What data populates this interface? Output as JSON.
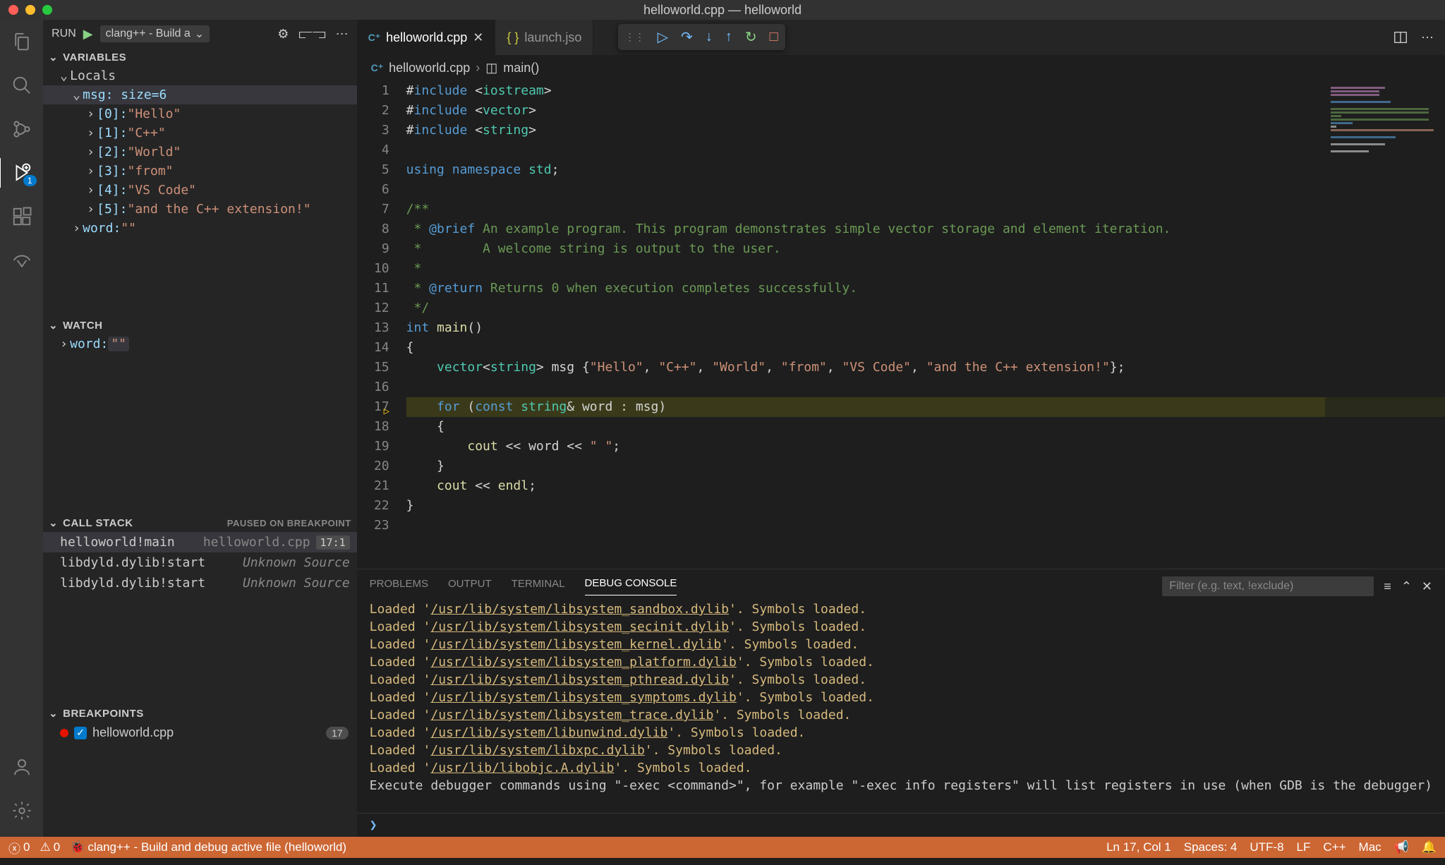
{
  "title": "helloworld.cpp — helloworld",
  "run": {
    "label": "RUN",
    "config": "clang++ - Build a"
  },
  "activity_badge": "1",
  "sections": {
    "variables": "VARIABLES",
    "watch": "WATCH",
    "callstack": "CALL STACK",
    "paused": "PAUSED ON BREAKPOINT",
    "breakpoints": "BREAKPOINTS"
  },
  "variables": {
    "locals": "Locals",
    "msg_label": "msg: size=6",
    "items": [
      {
        "idx": "[0]:",
        "val": "\"Hello\""
      },
      {
        "idx": "[1]:",
        "val": "\"C++\""
      },
      {
        "idx": "[2]:",
        "val": "\"World\""
      },
      {
        "idx": "[3]:",
        "val": "\"from\""
      },
      {
        "idx": "[4]:",
        "val": "\"VS Code\""
      },
      {
        "idx": "[5]:",
        "val": "\"and the C++ extension!\""
      }
    ],
    "word_label": "word:",
    "word_val": "\"\""
  },
  "watch": {
    "word_label": "word:",
    "word_val": "\"\""
  },
  "callstack": [
    {
      "name": "helloworld!main",
      "file": "helloworld.cpp",
      "loc": "17:1"
    },
    {
      "name": "libdyld.dylib!start",
      "file": "Unknown Source"
    },
    {
      "name": "libdyld.dylib!start",
      "file": "Unknown Source"
    }
  ],
  "breakpoints": [
    {
      "file": "helloworld.cpp",
      "line": "17"
    }
  ],
  "tabs": [
    {
      "name": "helloworld.cpp",
      "active": true
    },
    {
      "name": "launch.jso"
    }
  ],
  "breadcrumbs": {
    "file": "helloworld.cpp",
    "symbol": "main()"
  },
  "code": {
    "lines": [
      "#include <iostream>",
      "#include <vector>",
      "#include <string>",
      "",
      "using namespace std;",
      "",
      "/**",
      " * @brief An example program. This program demonstrates simple vector storage and element iteration.",
      " *        A welcome string is output to the user.",
      " *",
      " * @return Returns 0 when execution completes successfully.",
      " */",
      "int main()",
      "{",
      "    vector<string> msg {\"Hello\", \"C++\", \"World\", \"from\", \"VS Code\", \"and the C++ extension!\"};",
      "",
      "    for (const string& word : msg)",
      "    {",
      "        cout << word << \" \";",
      "    }",
      "    cout << endl;",
      "}",
      ""
    ],
    "current_line": 17
  },
  "panel": {
    "tabs": [
      "PROBLEMS",
      "OUTPUT",
      "TERMINAL",
      "DEBUG CONSOLE"
    ],
    "active": "DEBUG CONSOLE",
    "filter_placeholder": "Filter (e.g. text, !exclude)",
    "console": [
      {
        "pre": "Loaded '",
        "path": "/usr/lib/system/libsystem_sandbox.dylib",
        "post": "'. Symbols loaded."
      },
      {
        "pre": "Loaded '",
        "path": "/usr/lib/system/libsystem_secinit.dylib",
        "post": "'. Symbols loaded."
      },
      {
        "pre": "Loaded '",
        "path": "/usr/lib/system/libsystem_kernel.dylib",
        "post": "'. Symbols loaded."
      },
      {
        "pre": "Loaded '",
        "path": "/usr/lib/system/libsystem_platform.dylib",
        "post": "'. Symbols loaded."
      },
      {
        "pre": "Loaded '",
        "path": "/usr/lib/system/libsystem_pthread.dylib",
        "post": "'. Symbols loaded."
      },
      {
        "pre": "Loaded '",
        "path": "/usr/lib/system/libsystem_symptoms.dylib",
        "post": "'. Symbols loaded."
      },
      {
        "pre": "Loaded '",
        "path": "/usr/lib/system/libsystem_trace.dylib",
        "post": "'. Symbols loaded."
      },
      {
        "pre": "Loaded '",
        "path": "/usr/lib/system/libunwind.dylib",
        "post": "'. Symbols loaded."
      },
      {
        "pre": "Loaded '",
        "path": "/usr/lib/system/libxpc.dylib",
        "post": "'. Symbols loaded."
      },
      {
        "pre": "Loaded '",
        "path": "/usr/lib/libobjc.A.dylib",
        "post": "'. Symbols loaded."
      }
    ],
    "console_tail": "Execute debugger commands using \"-exec <command>\", for example \"-exec info registers\" will list registers in use (when GDB is the debugger)",
    "prompt": "❯"
  },
  "statusbar": {
    "errors": "0",
    "warnings": "0",
    "debug_config": "clang++ - Build and debug active file (helloworld)",
    "ln": "Ln 17, Col 1",
    "spaces": "Spaces: 4",
    "encoding": "UTF-8",
    "eol": "LF",
    "lang": "C++",
    "os": "Mac"
  }
}
